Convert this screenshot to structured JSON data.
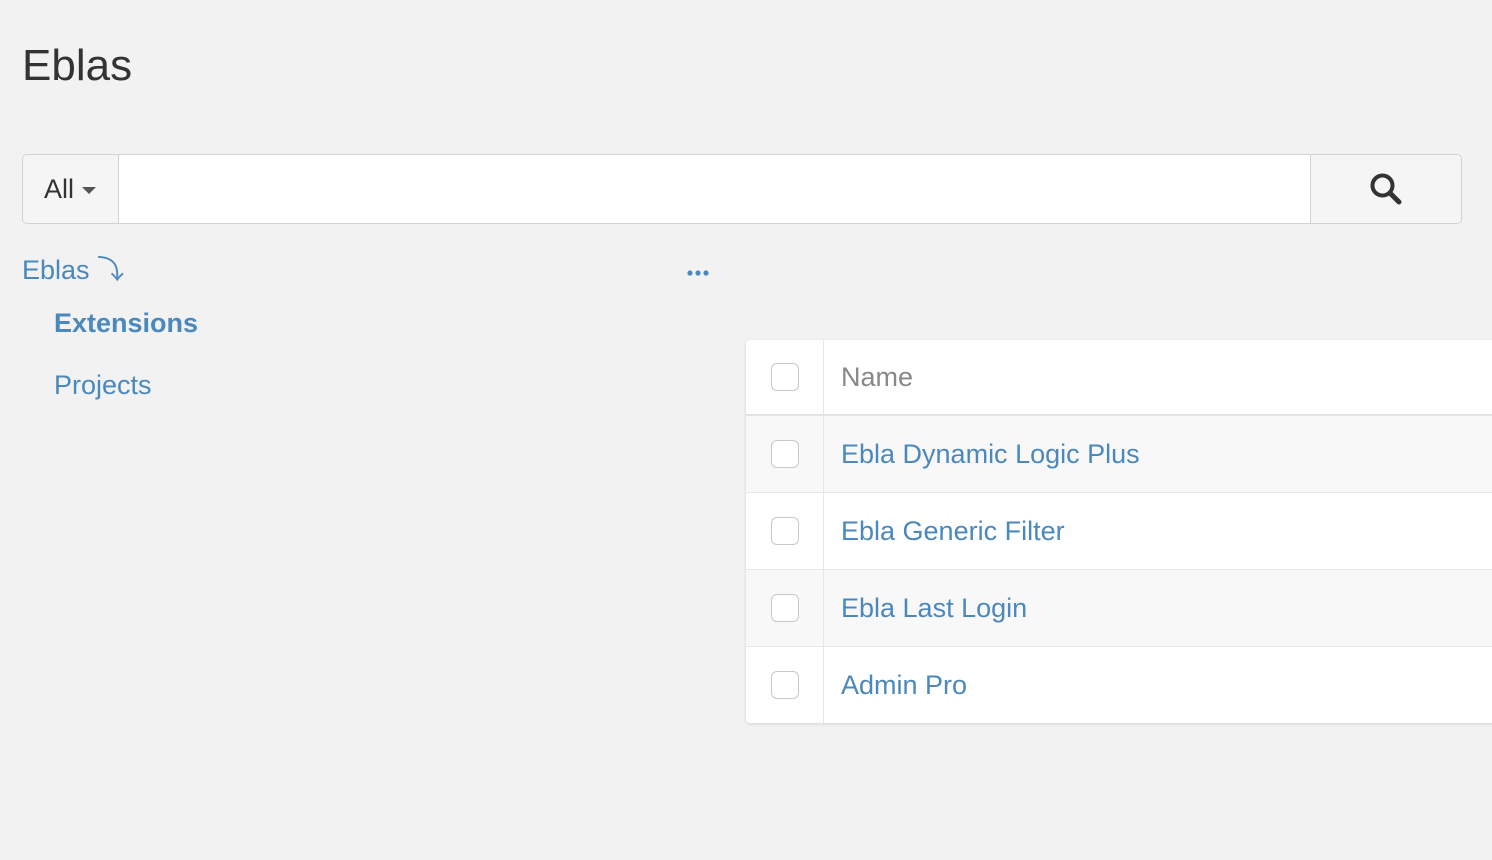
{
  "page": {
    "title": "Eblas"
  },
  "search": {
    "scope_label": "All",
    "value": "",
    "placeholder": "",
    "button_icon": "search-icon"
  },
  "breadcrumb": {
    "label": "Eblas",
    "arrow": "⤵"
  },
  "more_menu": {
    "label": "•••",
    "icon": "more-horizontal-icon"
  },
  "nav": {
    "items": [
      {
        "label": "Extensions",
        "active": true
      },
      {
        "label": "Projects",
        "active": false
      }
    ]
  },
  "table": {
    "header": {
      "name": "Name"
    },
    "rows": [
      {
        "name": "Ebla Dynamic Logic Plus"
      },
      {
        "name": "Ebla Generic Filter"
      },
      {
        "name": "Ebla Last Login"
      },
      {
        "name": "Admin Pro"
      }
    ]
  },
  "colors": {
    "background": "#f2f2f2",
    "link": "#4a88bd",
    "text": "#333333",
    "header_text": "#888888"
  }
}
